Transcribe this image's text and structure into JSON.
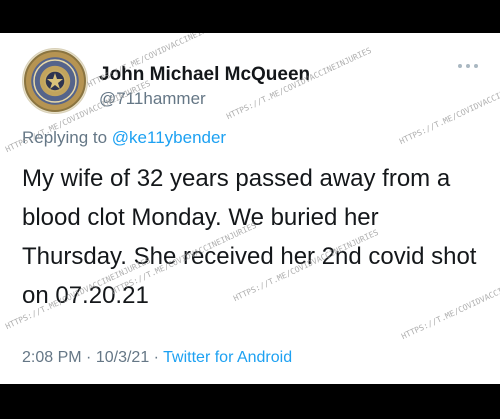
{
  "tweet": {
    "author": {
      "display_name": "John Michael McQueen",
      "handle": "@711hammer",
      "avatar": "retired-police-badge-avatar"
    },
    "more_icon": "more-horizontal-icon",
    "reply": {
      "prefix": "Replying to",
      "mention": "@ke11ybender"
    },
    "text": "My wife of 32 years passed away from a blood clot Monday. We buried her Thursday. She received her 2nd covid shot on 07.20.21",
    "meta": {
      "time": "2:08 PM",
      "separator": "·",
      "date": "10/3/21",
      "source": "Twitter for Android"
    }
  },
  "watermark": "HTTPS://T.ME/COVIDVACCINEINJURIES"
}
